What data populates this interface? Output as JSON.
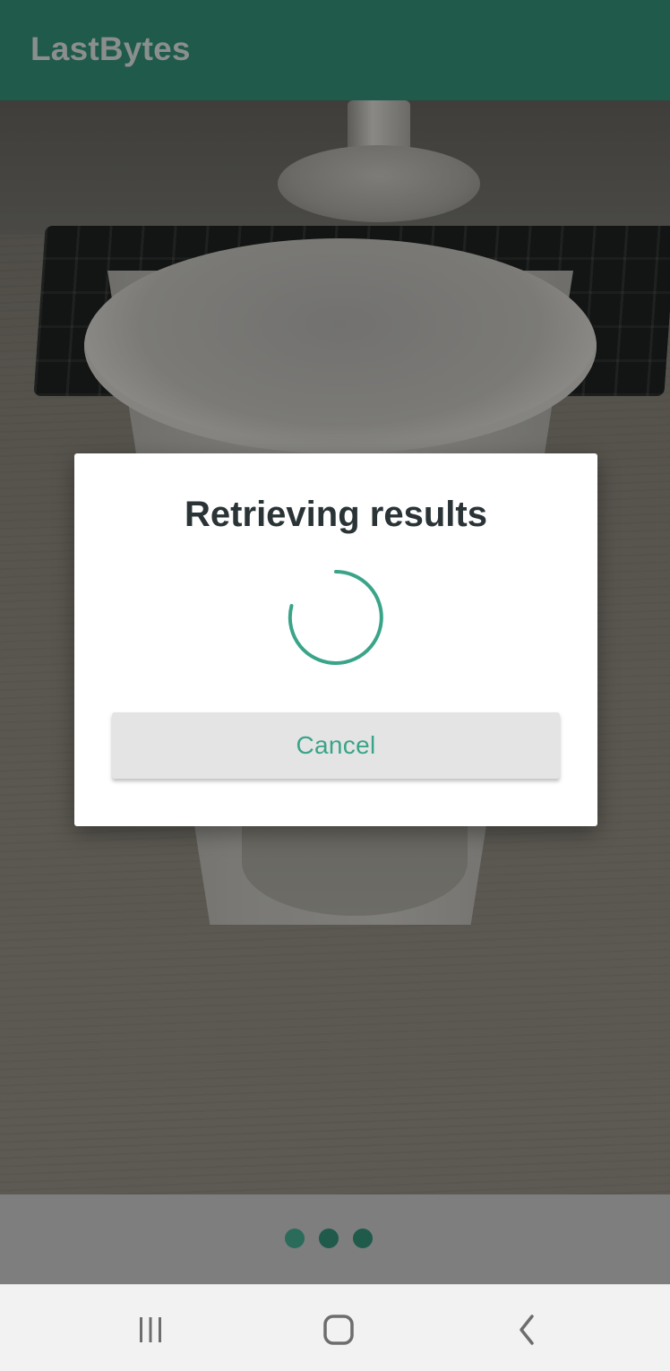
{
  "app_bar": {
    "title": "LastBytes"
  },
  "camera_preview": {
    "description_icon": "camera-preview"
  },
  "dialog": {
    "title": "Retrieving results",
    "spinner_icon": "loading-spinner-icon",
    "cancel_label": "Cancel"
  },
  "pager": {
    "dot_count": 3
  },
  "nav_bar": {
    "recents_icon": "recent-apps-icon",
    "home_icon": "home-icon",
    "back_icon": "back-icon"
  },
  "colors": {
    "app_bar": "#1f5a4b",
    "accent": "#3aa489",
    "dialog_background": "#ffffff",
    "button_background": "#e4e4e4",
    "nav_bar": "#f2f2f2"
  }
}
